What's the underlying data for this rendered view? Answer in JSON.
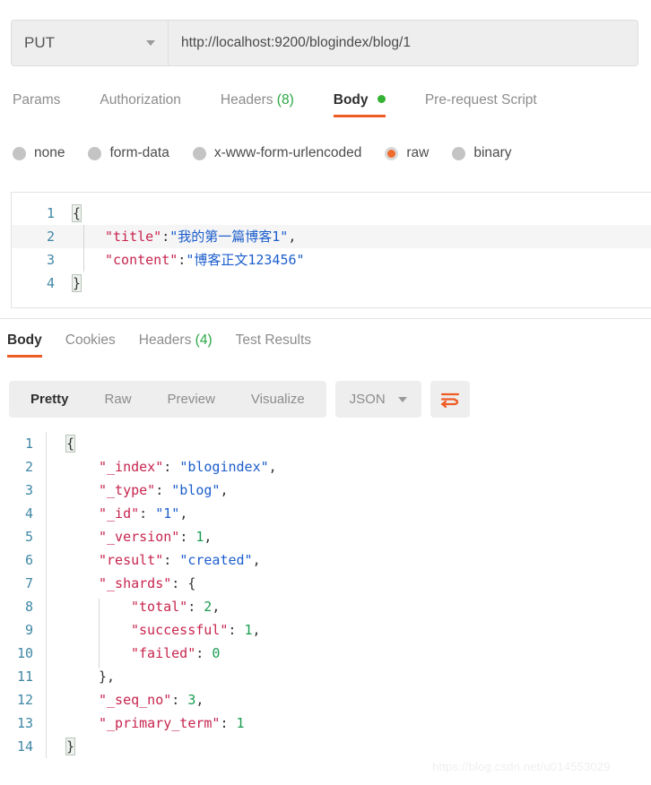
{
  "request_bar": {
    "method": "PUT",
    "method_caret_icon": "chevron-down-icon",
    "url": "http://localhost:9200/blogindex/blog/1"
  },
  "request_tabs": [
    {
      "label": "Params",
      "active": false
    },
    {
      "label": "Authorization",
      "active": false
    },
    {
      "label": "Headers",
      "count": "(8)",
      "active": false
    },
    {
      "label": "Body",
      "active": true,
      "indicator": "green-dot"
    },
    {
      "label": "Pre-request Script",
      "active": false
    }
  ],
  "body_type_options": [
    {
      "label": "none",
      "selected": false
    },
    {
      "label": "form-data",
      "selected": false
    },
    {
      "label": "x-www-form-urlencoded",
      "selected": false
    },
    {
      "label": "raw",
      "selected": true
    },
    {
      "label": "binary",
      "selected": false
    }
  ],
  "request_body": {
    "lines": [
      {
        "no": "1",
        "tokens": [
          {
            "t": "{",
            "c": "brace-match"
          }
        ]
      },
      {
        "no": "2",
        "highlight": true,
        "indent": 1,
        "tokens": [
          {
            "t": "\"title\"",
            "c": "tok-key"
          },
          {
            "t": ":",
            "c": "tok-punct"
          },
          {
            "t": "\"我的第一篇博客1\"",
            "c": "tok-str"
          },
          {
            "t": ",",
            "c": "tok-punct"
          }
        ]
      },
      {
        "no": "3",
        "indent": 1,
        "tokens": [
          {
            "t": "\"content\"",
            "c": "tok-key"
          },
          {
            "t": ":",
            "c": "tok-punct"
          },
          {
            "t": "\"博客正文123456\"",
            "c": "tok-str"
          }
        ]
      },
      {
        "no": "4",
        "tokens": [
          {
            "t": "}",
            "c": "brace-match"
          }
        ]
      }
    ]
  },
  "response_tabs": [
    {
      "label": "Body",
      "active": true
    },
    {
      "label": "Cookies",
      "active": false
    },
    {
      "label": "Headers",
      "count": "(4)",
      "active": false
    },
    {
      "label": "Test Results",
      "active": false
    }
  ],
  "response_toolbar": {
    "view_modes": [
      {
        "label": "Pretty",
        "active": true
      },
      {
        "label": "Raw",
        "active": false
      },
      {
        "label": "Preview",
        "active": false
      },
      {
        "label": "Visualize",
        "active": false
      }
    ],
    "format": "JSON",
    "format_caret_icon": "chevron-down-icon",
    "wrap_lines_icon": "wrap-lines-icon"
  },
  "response_body": {
    "lines": [
      {
        "no": "1",
        "indent": 0,
        "tokens": [
          {
            "t": "{",
            "c": "brace-match"
          }
        ]
      },
      {
        "no": "2",
        "indent": 1,
        "tokens": [
          {
            "t": "\"_index\"",
            "c": "tok-key"
          },
          {
            "t": ": ",
            "c": "tok-punct"
          },
          {
            "t": "\"blogindex\"",
            "c": "tok-str"
          },
          {
            "t": ",",
            "c": "tok-punct"
          }
        ]
      },
      {
        "no": "3",
        "indent": 1,
        "tokens": [
          {
            "t": "\"_type\"",
            "c": "tok-key"
          },
          {
            "t": ": ",
            "c": "tok-punct"
          },
          {
            "t": "\"blog\"",
            "c": "tok-str"
          },
          {
            "t": ",",
            "c": "tok-punct"
          }
        ]
      },
      {
        "no": "4",
        "indent": 1,
        "tokens": [
          {
            "t": "\"_id\"",
            "c": "tok-key"
          },
          {
            "t": ": ",
            "c": "tok-punct"
          },
          {
            "t": "\"1\"",
            "c": "tok-str"
          },
          {
            "t": ",",
            "c": "tok-punct"
          }
        ]
      },
      {
        "no": "5",
        "indent": 1,
        "tokens": [
          {
            "t": "\"_version\"",
            "c": "tok-key"
          },
          {
            "t": ": ",
            "c": "tok-punct"
          },
          {
            "t": "1",
            "c": "tok-num"
          },
          {
            "t": ",",
            "c": "tok-punct"
          }
        ]
      },
      {
        "no": "6",
        "indent": 1,
        "tokens": [
          {
            "t": "\"result\"",
            "c": "tok-key"
          },
          {
            "t": ": ",
            "c": "tok-punct"
          },
          {
            "t": "\"created\"",
            "c": "tok-str"
          },
          {
            "t": ",",
            "c": "tok-punct"
          }
        ]
      },
      {
        "no": "7",
        "indent": 1,
        "tokens": [
          {
            "t": "\"_shards\"",
            "c": "tok-key"
          },
          {
            "t": ": ",
            "c": "tok-punct"
          },
          {
            "t": "{",
            "c": "tok-punct"
          }
        ]
      },
      {
        "no": "8",
        "indent": 2,
        "tokens": [
          {
            "t": "\"total\"",
            "c": "tok-key"
          },
          {
            "t": ": ",
            "c": "tok-punct"
          },
          {
            "t": "2",
            "c": "tok-num"
          },
          {
            "t": ",",
            "c": "tok-punct"
          }
        ]
      },
      {
        "no": "9",
        "indent": 2,
        "tokens": [
          {
            "t": "\"successful\"",
            "c": "tok-key"
          },
          {
            "t": ": ",
            "c": "tok-punct"
          },
          {
            "t": "1",
            "c": "tok-num"
          },
          {
            "t": ",",
            "c": "tok-punct"
          }
        ]
      },
      {
        "no": "10",
        "indent": 2,
        "tokens": [
          {
            "t": "\"failed\"",
            "c": "tok-key"
          },
          {
            "t": ": ",
            "c": "tok-punct"
          },
          {
            "t": "0",
            "c": "tok-num"
          }
        ]
      },
      {
        "no": "11",
        "indent": 1,
        "tokens": [
          {
            "t": "}",
            "c": "tok-punct"
          },
          {
            "t": ",",
            "c": "tok-punct"
          }
        ]
      },
      {
        "no": "12",
        "indent": 1,
        "tokens": [
          {
            "t": "\"_seq_no\"",
            "c": "tok-key"
          },
          {
            "t": ": ",
            "c": "tok-punct"
          },
          {
            "t": "3",
            "c": "tok-num"
          },
          {
            "t": ",",
            "c": "tok-punct"
          }
        ]
      },
      {
        "no": "13",
        "indent": 1,
        "tokens": [
          {
            "t": "\"_primary_term\"",
            "c": "tok-key"
          },
          {
            "t": ": ",
            "c": "tok-punct"
          },
          {
            "t": "1",
            "c": "tok-num"
          }
        ]
      },
      {
        "no": "14",
        "indent": 0,
        "tokens": [
          {
            "t": "}",
            "c": "brace-match"
          }
        ]
      }
    ]
  },
  "watermark": "https://blog.csdn.net/u014553029",
  "colors": {
    "accent": "#ef5b25",
    "green": "#34b233",
    "key": "#c7254e",
    "string": "#1c5ecc",
    "number": "#1a9c52",
    "gutter": "#3f87a6"
  }
}
